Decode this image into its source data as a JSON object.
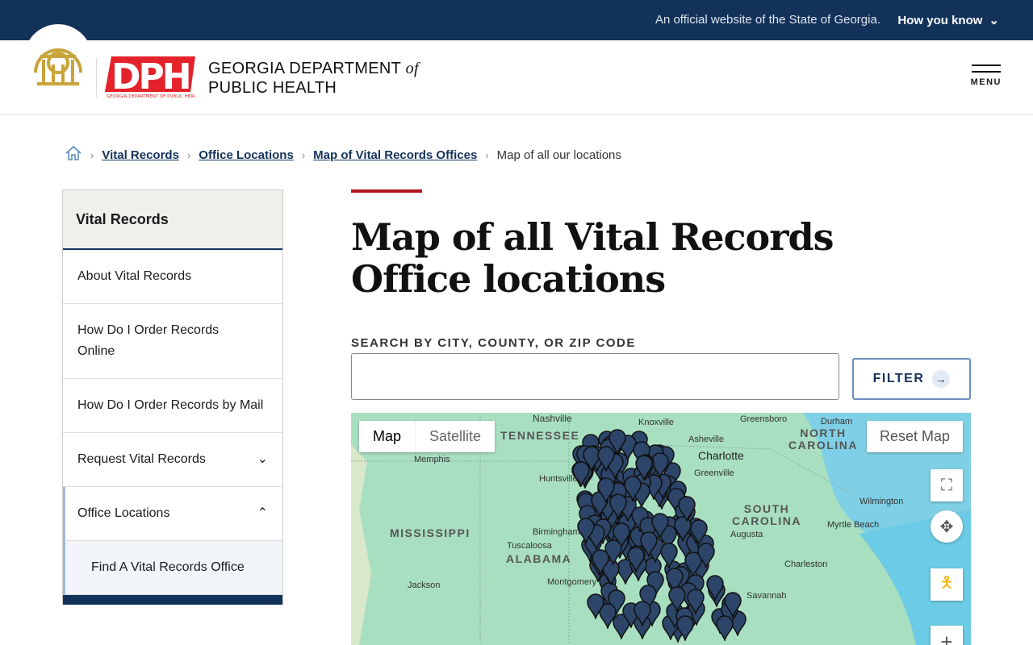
{
  "topbar": {
    "official": "An official website of the State of Georgia.",
    "how": "How you know"
  },
  "header": {
    "logo_text": "DPH",
    "logo_sub": "GEORGIA DEPARTMENT OF PUBLIC HEALTH",
    "org_line1": "GEORGIA DEPARTMENT ",
    "org_of": "of",
    "org_line2": "PUBLIC HEALTH",
    "menu": "MENU"
  },
  "breadcrumb": [
    "Vital Records",
    "Office Locations",
    "Map of Vital Records Offices",
    "Map of all our locations"
  ],
  "sidebar": {
    "title": "Vital Records",
    "items": [
      "About Vital Records",
      "How Do I Order Records Online",
      "How Do I Order Records by Mail",
      "Request Vital Records",
      "Office Locations"
    ],
    "sub": "Find A Vital Records Office"
  },
  "main": {
    "title": "Map of all Vital Records Office locations",
    "search_label": "SEARCH BY CITY, COUNTY, OR ZIP CODE",
    "search_value": "",
    "filter": "FILTER"
  },
  "map": {
    "type_map": "Map",
    "type_satellite": "Satellite",
    "reset": "Reset Map",
    "cities": [
      "Nashville",
      "Knoxville",
      "Greensboro",
      "Durham",
      "Asheville",
      "Charlotte",
      "Greenville",
      "Memphis",
      "Huntsville",
      "Wilmington",
      "Birmingham",
      "Tuscaloosa",
      "Myrtle Beach",
      "Jackson",
      "Montgomery",
      "Charleston",
      "Savannah",
      "Augusta"
    ],
    "states": [
      "TENNESSEE",
      "NORTH CAROLINA",
      "SOUTH CAROLINA",
      "MISSISSIPPI",
      "ALABAMA"
    ],
    "marker_color": "#2c4569"
  }
}
